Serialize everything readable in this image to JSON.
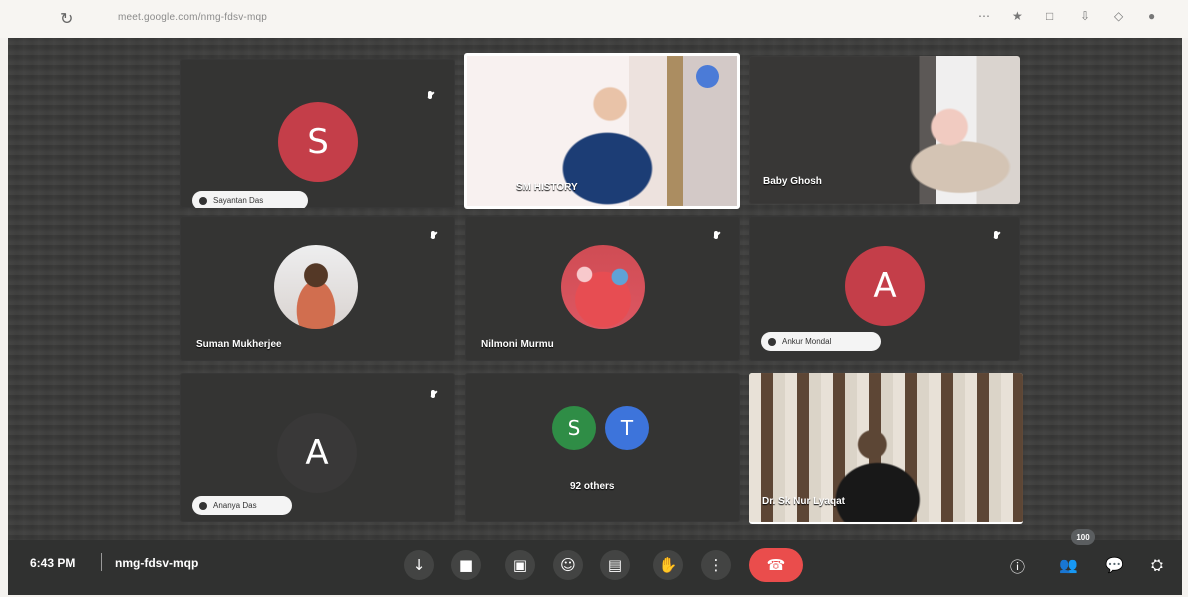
{
  "browser": {
    "url": "meet.google.com/nmg-fdsv-mqp",
    "icons": [
      "reload-icon",
      "more-icon",
      "star-icon",
      "window-icon",
      "download-icon",
      "extension-icon",
      "profile-icon"
    ]
  },
  "participants": [
    {
      "id": "sayantan",
      "type": "letter-avatar",
      "initial": "S",
      "name": "Sayantan Das",
      "avatar_color": "#c43e49"
    },
    {
      "id": "history",
      "type": "video",
      "name": "SM HISTORY"
    },
    {
      "id": "baby",
      "type": "video",
      "name": "Baby Ghosh"
    },
    {
      "id": "suman",
      "type": "photo-avatar",
      "name": "Suman Mukherjee"
    },
    {
      "id": "nilmoni",
      "type": "photo-avatar",
      "name": "Nilmoni Murmu"
    },
    {
      "id": "ankur",
      "type": "letter-avatar",
      "initial": "A",
      "name": "Ankur Mondal",
      "avatar_color": "#c43e49"
    },
    {
      "id": "ananya",
      "type": "letter-avatar",
      "initial": "A",
      "name": "Ananya Das",
      "avatar_color": "#393838"
    },
    {
      "id": "others",
      "type": "others-tile",
      "initials": [
        "S",
        "T"
      ],
      "label": "92 others",
      "colors": [
        "#2f8d46",
        "#3d74db"
      ]
    },
    {
      "id": "lyaqat",
      "type": "video",
      "name": "Dr. Sk Nur Lyaqat"
    }
  ],
  "bottom_bar": {
    "time": "6:43 PM",
    "meeting_code": "nmg-fdsv-mqp",
    "controls": [
      {
        "name": "microphone-button",
        "icon": "microphone-icon",
        "glyph": "↓"
      },
      {
        "name": "camera-button",
        "icon": "camera-icon",
        "glyph": "■"
      },
      {
        "name": "captions-button",
        "icon": "captions-icon",
        "glyph": "▣"
      },
      {
        "name": "emoji-button",
        "icon": "emoji-icon",
        "glyph": "☺"
      },
      {
        "name": "present-button",
        "icon": "present-icon",
        "glyph": "▤"
      },
      {
        "name": "raise-hand-button",
        "icon": "hand-icon",
        "glyph": "✋"
      },
      {
        "name": "more-options-button",
        "icon": "more-vertical-icon",
        "glyph": "⋮"
      },
      {
        "name": "leave-call-button",
        "icon": "phone-hangup-icon",
        "glyph": "☎"
      }
    ],
    "right_icons": [
      {
        "name": "meeting-info-button",
        "icon": "info-icon",
        "glyph": "ⓘ"
      },
      {
        "name": "people-button",
        "icon": "people-icon",
        "glyph": "👥",
        "badge": "100"
      },
      {
        "name": "chat-button",
        "icon": "chat-icon",
        "glyph": "💬"
      },
      {
        "name": "activities-button",
        "icon": "activities-icon",
        "glyph": "⛭"
      }
    ]
  }
}
